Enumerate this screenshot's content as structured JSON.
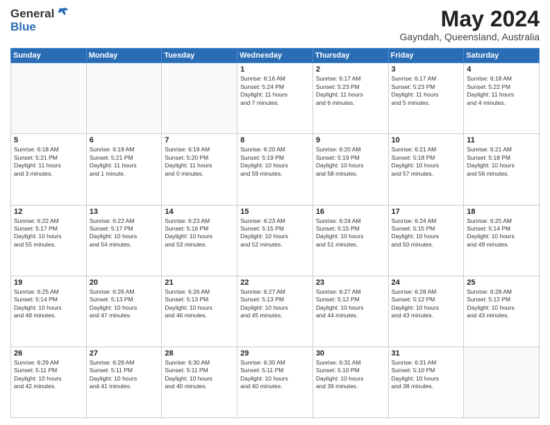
{
  "header": {
    "logo_general": "General",
    "logo_blue": "Blue",
    "title": "May 2024",
    "location": "Gayndah, Queensland, Australia"
  },
  "days_of_week": [
    "Sunday",
    "Monday",
    "Tuesday",
    "Wednesday",
    "Thursday",
    "Friday",
    "Saturday"
  ],
  "weeks": [
    [
      {
        "day": "",
        "info": ""
      },
      {
        "day": "",
        "info": ""
      },
      {
        "day": "",
        "info": ""
      },
      {
        "day": "1",
        "info": "Sunrise: 6:16 AM\nSunset: 5:24 PM\nDaylight: 11 hours\nand 7 minutes."
      },
      {
        "day": "2",
        "info": "Sunrise: 6:17 AM\nSunset: 5:23 PM\nDaylight: 11 hours\nand 6 minutes."
      },
      {
        "day": "3",
        "info": "Sunrise: 6:17 AM\nSunset: 5:23 PM\nDaylight: 11 hours\nand 5 minutes."
      },
      {
        "day": "4",
        "info": "Sunrise: 6:18 AM\nSunset: 5:22 PM\nDaylight: 11 hours\nand 4 minutes."
      }
    ],
    [
      {
        "day": "5",
        "info": "Sunrise: 6:18 AM\nSunset: 5:21 PM\nDaylight: 11 hours\nand 3 minutes."
      },
      {
        "day": "6",
        "info": "Sunrise: 6:19 AM\nSunset: 5:21 PM\nDaylight: 11 hours\nand 1 minute."
      },
      {
        "day": "7",
        "info": "Sunrise: 6:19 AM\nSunset: 5:20 PM\nDaylight: 11 hours\nand 0 minutes."
      },
      {
        "day": "8",
        "info": "Sunrise: 6:20 AM\nSunset: 5:19 PM\nDaylight: 10 hours\nand 59 minutes."
      },
      {
        "day": "9",
        "info": "Sunrise: 6:20 AM\nSunset: 5:19 PM\nDaylight: 10 hours\nand 58 minutes."
      },
      {
        "day": "10",
        "info": "Sunrise: 6:21 AM\nSunset: 5:18 PM\nDaylight: 10 hours\nand 57 minutes."
      },
      {
        "day": "11",
        "info": "Sunrise: 6:21 AM\nSunset: 5:18 PM\nDaylight: 10 hours\nand 56 minutes."
      }
    ],
    [
      {
        "day": "12",
        "info": "Sunrise: 6:22 AM\nSunset: 5:17 PM\nDaylight: 10 hours\nand 55 minutes."
      },
      {
        "day": "13",
        "info": "Sunrise: 6:22 AM\nSunset: 5:17 PM\nDaylight: 10 hours\nand 54 minutes."
      },
      {
        "day": "14",
        "info": "Sunrise: 6:23 AM\nSunset: 5:16 PM\nDaylight: 10 hours\nand 53 minutes."
      },
      {
        "day": "15",
        "info": "Sunrise: 6:23 AM\nSunset: 5:15 PM\nDaylight: 10 hours\nand 52 minutes."
      },
      {
        "day": "16",
        "info": "Sunrise: 6:24 AM\nSunset: 5:15 PM\nDaylight: 10 hours\nand 51 minutes."
      },
      {
        "day": "17",
        "info": "Sunrise: 6:24 AM\nSunset: 5:15 PM\nDaylight: 10 hours\nand 50 minutes."
      },
      {
        "day": "18",
        "info": "Sunrise: 6:25 AM\nSunset: 5:14 PM\nDaylight: 10 hours\nand 49 minutes."
      }
    ],
    [
      {
        "day": "19",
        "info": "Sunrise: 6:25 AM\nSunset: 5:14 PM\nDaylight: 10 hours\nand 48 minutes."
      },
      {
        "day": "20",
        "info": "Sunrise: 6:26 AM\nSunset: 5:13 PM\nDaylight: 10 hours\nand 47 minutes."
      },
      {
        "day": "21",
        "info": "Sunrise: 6:26 AM\nSunset: 5:13 PM\nDaylight: 10 hours\nand 46 minutes."
      },
      {
        "day": "22",
        "info": "Sunrise: 6:27 AM\nSunset: 5:13 PM\nDaylight: 10 hours\nand 45 minutes."
      },
      {
        "day": "23",
        "info": "Sunrise: 6:27 AM\nSunset: 5:12 PM\nDaylight: 10 hours\nand 44 minutes."
      },
      {
        "day": "24",
        "info": "Sunrise: 6:28 AM\nSunset: 5:12 PM\nDaylight: 10 hours\nand 43 minutes."
      },
      {
        "day": "25",
        "info": "Sunrise: 6:28 AM\nSunset: 5:12 PM\nDaylight: 10 hours\nand 43 minutes."
      }
    ],
    [
      {
        "day": "26",
        "info": "Sunrise: 6:29 AM\nSunset: 5:11 PM\nDaylight: 10 hours\nand 42 minutes."
      },
      {
        "day": "27",
        "info": "Sunrise: 6:29 AM\nSunset: 5:11 PM\nDaylight: 10 hours\nand 41 minutes."
      },
      {
        "day": "28",
        "info": "Sunrise: 6:30 AM\nSunset: 5:11 PM\nDaylight: 10 hours\nand 40 minutes."
      },
      {
        "day": "29",
        "info": "Sunrise: 6:30 AM\nSunset: 5:11 PM\nDaylight: 10 hours\nand 40 minutes."
      },
      {
        "day": "30",
        "info": "Sunrise: 6:31 AM\nSunset: 5:10 PM\nDaylight: 10 hours\nand 39 minutes."
      },
      {
        "day": "31",
        "info": "Sunrise: 6:31 AM\nSunset: 5:10 PM\nDaylight: 10 hours\nand 38 minutes."
      },
      {
        "day": "",
        "info": ""
      }
    ]
  ]
}
